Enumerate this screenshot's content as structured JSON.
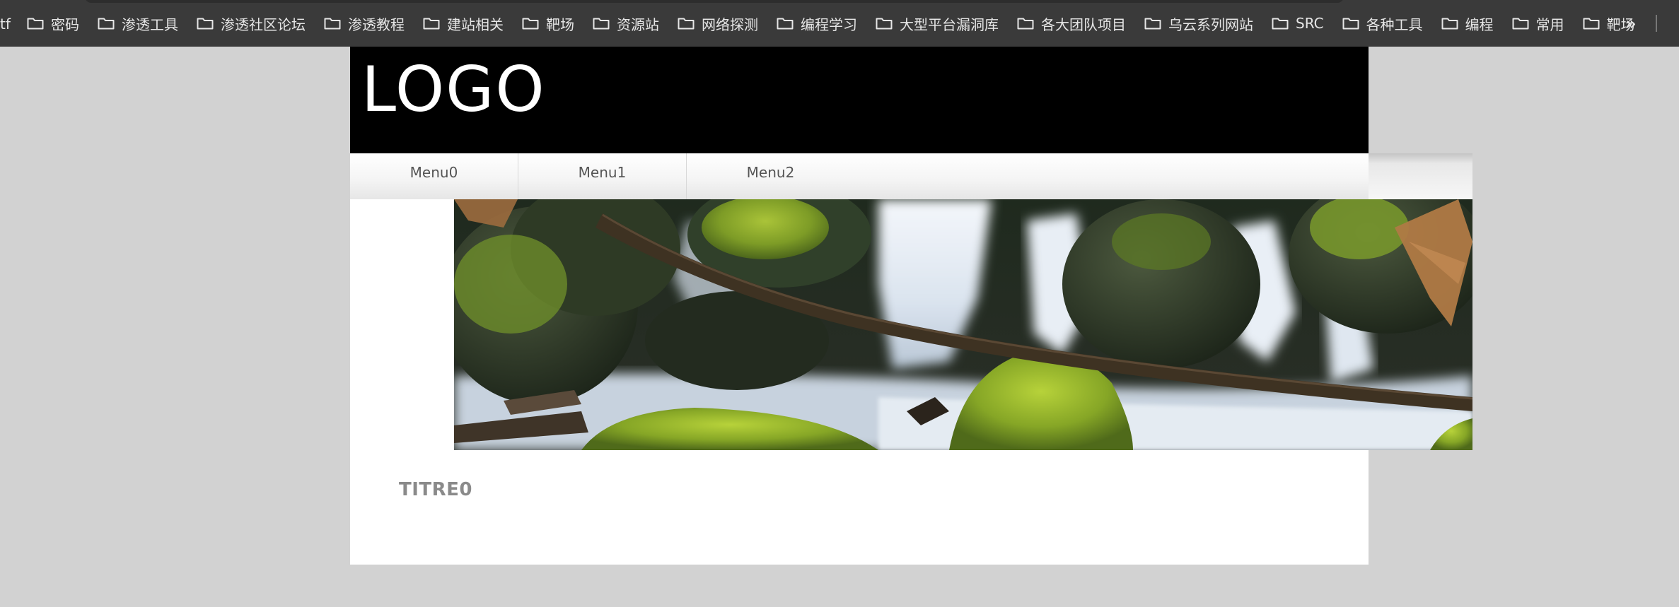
{
  "bookmarks_bar": {
    "prefix_text": "tf",
    "items": [
      {
        "label": "密码"
      },
      {
        "label": "渗透工具"
      },
      {
        "label": "渗透社区论坛"
      },
      {
        "label": "渗透教程"
      },
      {
        "label": "建站相关"
      },
      {
        "label": "靶场"
      },
      {
        "label": "资源站"
      },
      {
        "label": "网络探测"
      },
      {
        "label": "编程学习"
      },
      {
        "label": "大型平台漏洞库"
      },
      {
        "label": "各大团队项目"
      },
      {
        "label": "乌云系列网站"
      },
      {
        "label": "SRC"
      },
      {
        "label": "各种工具"
      },
      {
        "label": "编程"
      },
      {
        "label": "常用"
      },
      {
        "label": "靶场"
      }
    ],
    "item_icon": "folder-icon",
    "overflow_label": "»"
  },
  "site": {
    "logo_text": "LOGO",
    "menu": [
      {
        "label": "Menu0"
      },
      {
        "label": "Menu1"
      },
      {
        "label": "Menu2"
      }
    ],
    "banner_image": "waterfall-photo",
    "title": "TITRE0"
  },
  "colors": {
    "browser_chrome": "#3a3a3a",
    "page_background": "#d2d2d2",
    "header_background": "#000000",
    "content_background": "#ffffff",
    "title_color": "#8a8a8a"
  }
}
